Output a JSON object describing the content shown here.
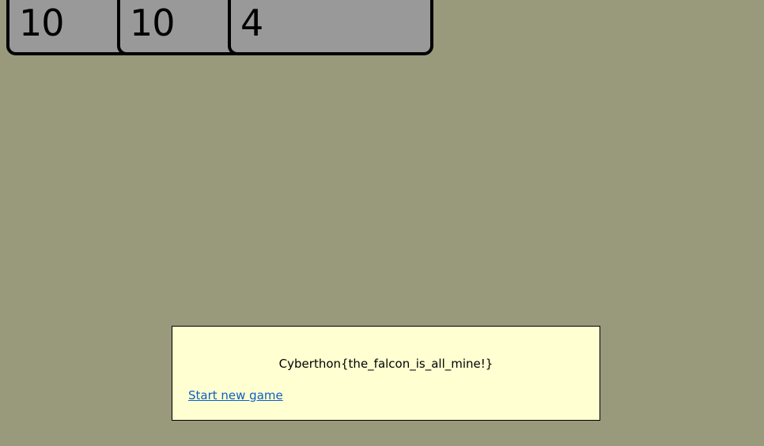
{
  "cards": [
    {
      "value": "10"
    },
    {
      "value": "10"
    },
    {
      "value": "4"
    }
  ],
  "dialog": {
    "message": "Cyberthon{the_falcon_is_all_mine!}",
    "new_game_link": "Start new game"
  },
  "colors": {
    "background": "#99997c",
    "card_fill": "#999999",
    "dialog_fill": "#ffffd1",
    "link": "#0a5fc2"
  }
}
